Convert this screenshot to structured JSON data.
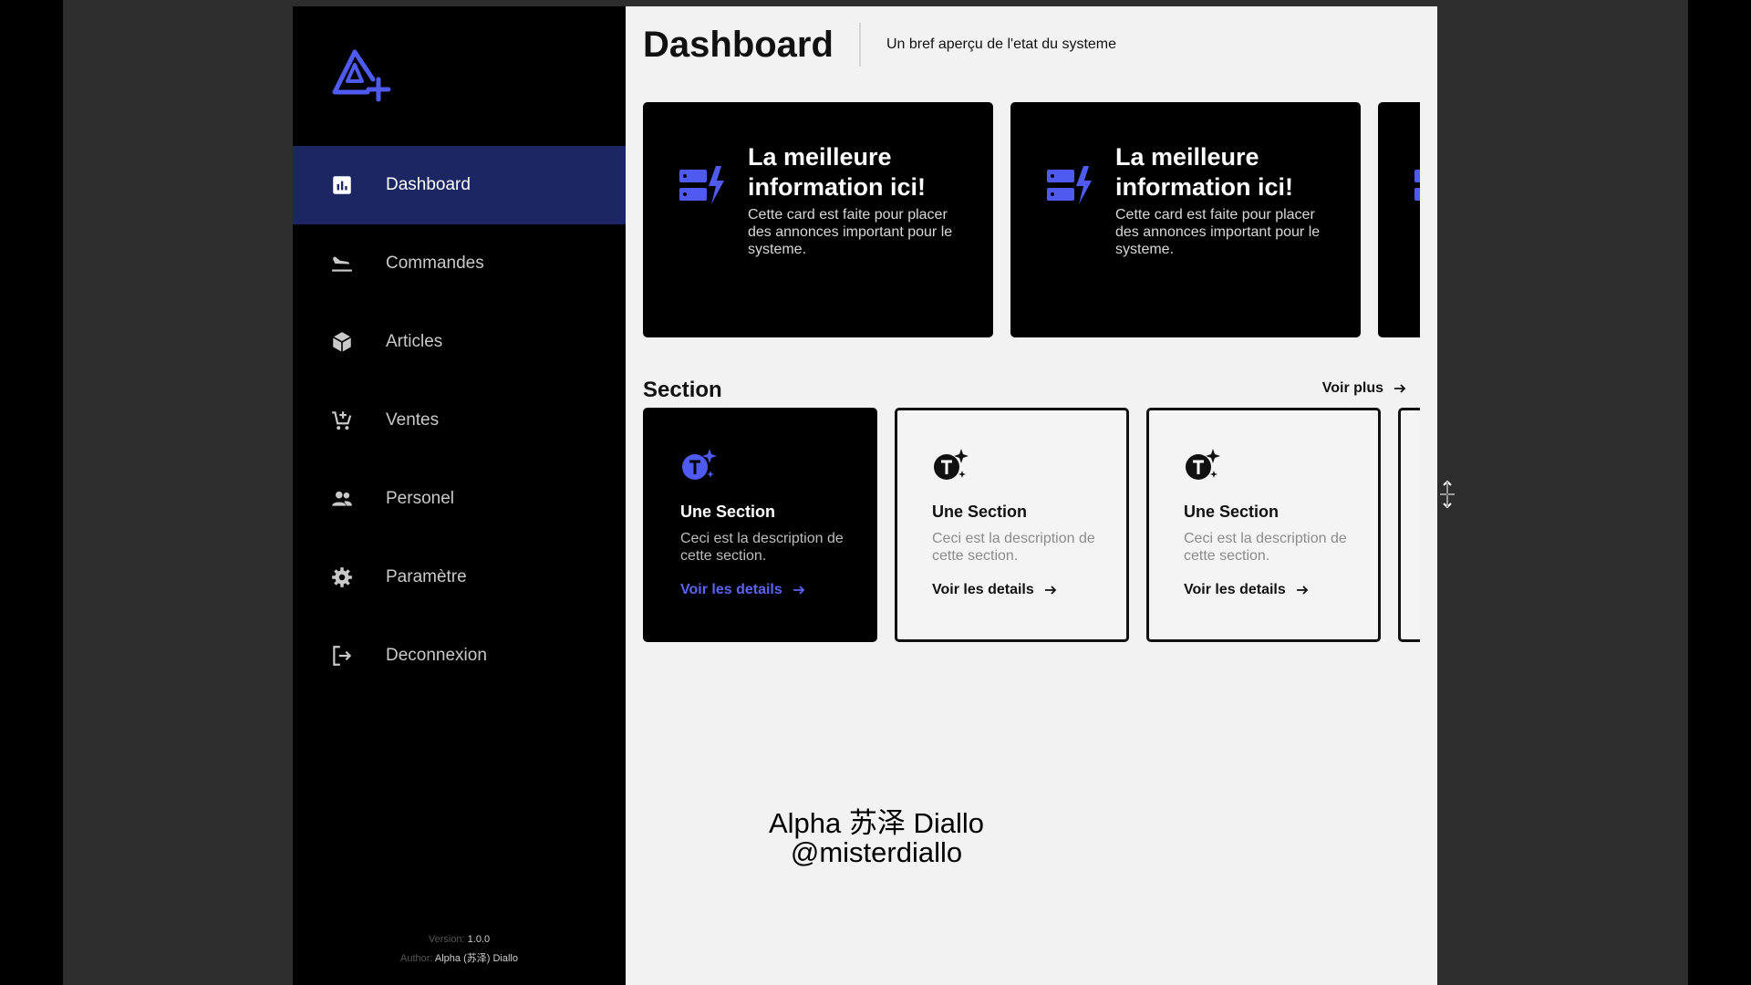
{
  "sidebar": {
    "logo_icon": "a-plus-logo-icon",
    "items": [
      {
        "label": "Dashboard",
        "icon": "chart-icon",
        "active": true
      },
      {
        "label": "Commandes",
        "icon": "plane-landing-icon",
        "active": false
      },
      {
        "label": "Articles",
        "icon": "cube-icon",
        "active": false
      },
      {
        "label": "Ventes",
        "icon": "cart-add-icon",
        "active": false
      },
      {
        "label": "Personel",
        "icon": "people-icon",
        "active": false
      },
      {
        "label": "Paramètre",
        "icon": "gear-icon",
        "active": false
      },
      {
        "label": "Deconnexion",
        "icon": "logout-icon",
        "active": false
      }
    ],
    "version_label": "Version:",
    "version_value": "1.0.0",
    "author_label": "Author:",
    "author_value": "Alpha (苏泽) Diallo"
  },
  "header": {
    "title": "Dashboard",
    "subtitle": "Un bref aperçu de l'etat du systeme"
  },
  "promo_cards": [
    {
      "title": "La meilleure information ici!",
      "text": "Cette card est faite pour placer des annonces important pour le systeme."
    },
    {
      "title": "La meilleure information ici!",
      "text": "Cette card est faite pour placer des annonces important pour le systeme."
    }
  ],
  "section": {
    "title": "Section",
    "see_more": "Voir plus",
    "cards": [
      {
        "title": "Une Section",
        "desc": "Ceci est la description de cette section.",
        "link": "Voir les details"
      },
      {
        "title": "Une Section",
        "desc": "Ceci est la description de cette section.",
        "link": "Voir les details"
      },
      {
        "title": "Une Section",
        "desc": "Ceci est la description de cette section.",
        "link": "Voir les details"
      }
    ]
  },
  "watermark": {
    "line1": "Alpha 苏泽 Diallo",
    "line2": "@misterdiallo"
  },
  "colors": {
    "accent": "#4f5bf0",
    "active_nav_bg": "#1b2663",
    "sidebar_bg": "#000000",
    "main_bg": "#f2f2f2"
  }
}
